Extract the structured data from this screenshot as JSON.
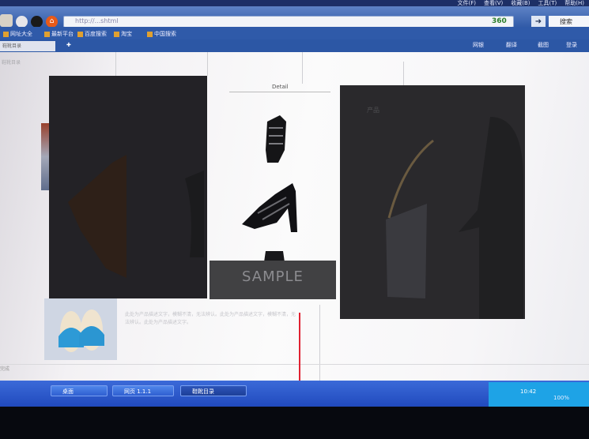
{
  "menu": [
    "文件(F)",
    "查看(V)",
    "收藏(B)",
    "工具(T)",
    "帮助(H)"
  ],
  "address": {
    "url": "http://...shtml"
  },
  "browser": {
    "brand": "360",
    "search_label": "搜索"
  },
  "favorites": [
    "网址大全",
    "最新平台",
    "百度搜索",
    "淘宝",
    "中国搜索"
  ],
  "tab": {
    "title": "鞋靴目录"
  },
  "right_buttons": [
    "网银",
    "翻译",
    "截图",
    "登录"
  ],
  "page": {
    "title": "鞋靴目录",
    "detail_heading": "Detail",
    "sample_watermark": "SAMPLE",
    "dark_title": "产品",
    "paragraph": "此处为产品描述文字，模糊不清，无法辨认。此处为产品描述文字，模糊不清，无法辨认。此处为产品描述文字。",
    "status": "完成"
  },
  "taskbar": {
    "items": [
      "桌面",
      "网页 1.1.1",
      "鞋靴目录"
    ],
    "clock": "10:42",
    "zoom": "100%"
  },
  "colors": {
    "title_bar": "#1d2f66",
    "accent_red": "#e02232",
    "taskbar": "#2f5fd1"
  }
}
